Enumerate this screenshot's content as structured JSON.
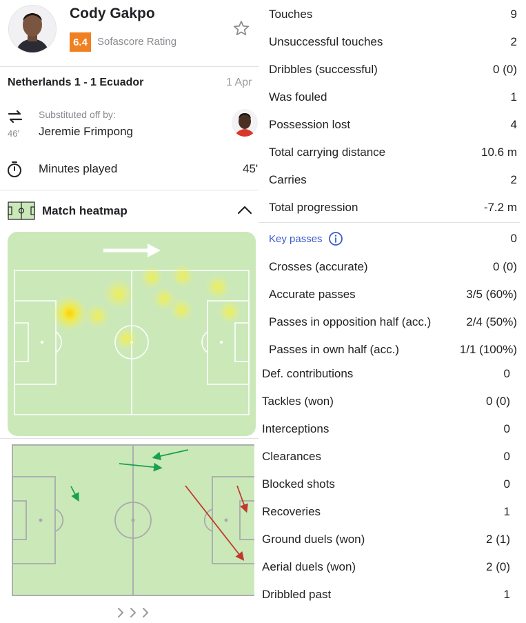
{
  "player": {
    "name": "Cody Gakpo",
    "rating": "6.4",
    "rating_label": "Sofascore Rating"
  },
  "match": {
    "title": "Netherlands 1 - 1 Ecuador",
    "date": "1 Apr"
  },
  "substitution": {
    "minute": "46'",
    "label": "Substituted off by:",
    "player": "Jeremie Frimpong"
  },
  "minutes": {
    "label": "Minutes played",
    "value": "45'"
  },
  "heatmap": {
    "title": "Match heatmap"
  },
  "colors": {
    "accent_rating": "#f08022",
    "pitch": "#cbe8b9",
    "successful_pass": "#1aa052",
    "failed_pass": "#c0392b",
    "link": "#3a5ad1"
  },
  "stats_top": [
    {
      "label": "Touches",
      "value": "9"
    },
    {
      "label": "Unsuccessful touches",
      "value": "2"
    },
    {
      "label": "Dribbles (successful)",
      "value": "0 (0)"
    },
    {
      "label": "Was fouled",
      "value": "1"
    },
    {
      "label": "Possession lost",
      "value": "4"
    },
    {
      "label": "Total carrying distance",
      "value": "10.6 m"
    },
    {
      "label": "Carries",
      "value": "2"
    },
    {
      "label": "Total progression",
      "value": "-7.2 m"
    }
  ],
  "key_passes": {
    "label": "Key passes",
    "value": "0"
  },
  "stats_passing": [
    {
      "label": "Crosses (accurate)",
      "value": "0 (0)"
    },
    {
      "label": "Accurate passes",
      "value": "3/5 (60%)"
    },
    {
      "label": "Passes in opposition half (acc.)",
      "value": "2/4 (50%)"
    },
    {
      "label": "Passes in own half (acc.)",
      "value": "1/1 (100%)"
    }
  ],
  "stats_defence": [
    {
      "label": "Def. contributions",
      "value": "0"
    },
    {
      "label": "Tackles (won)",
      "value": "0 (0)"
    },
    {
      "label": "Interceptions",
      "value": "0"
    },
    {
      "label": "Clearances",
      "value": "0"
    },
    {
      "label": "Blocked shots",
      "value": "0"
    },
    {
      "label": "Recoveries",
      "value": "1"
    },
    {
      "label": "Ground duels (won)",
      "value": "2 (1)"
    },
    {
      "label": "Aerial duels (won)",
      "value": "2 (0)"
    },
    {
      "label": "Dribbled past",
      "value": "1"
    }
  ]
}
